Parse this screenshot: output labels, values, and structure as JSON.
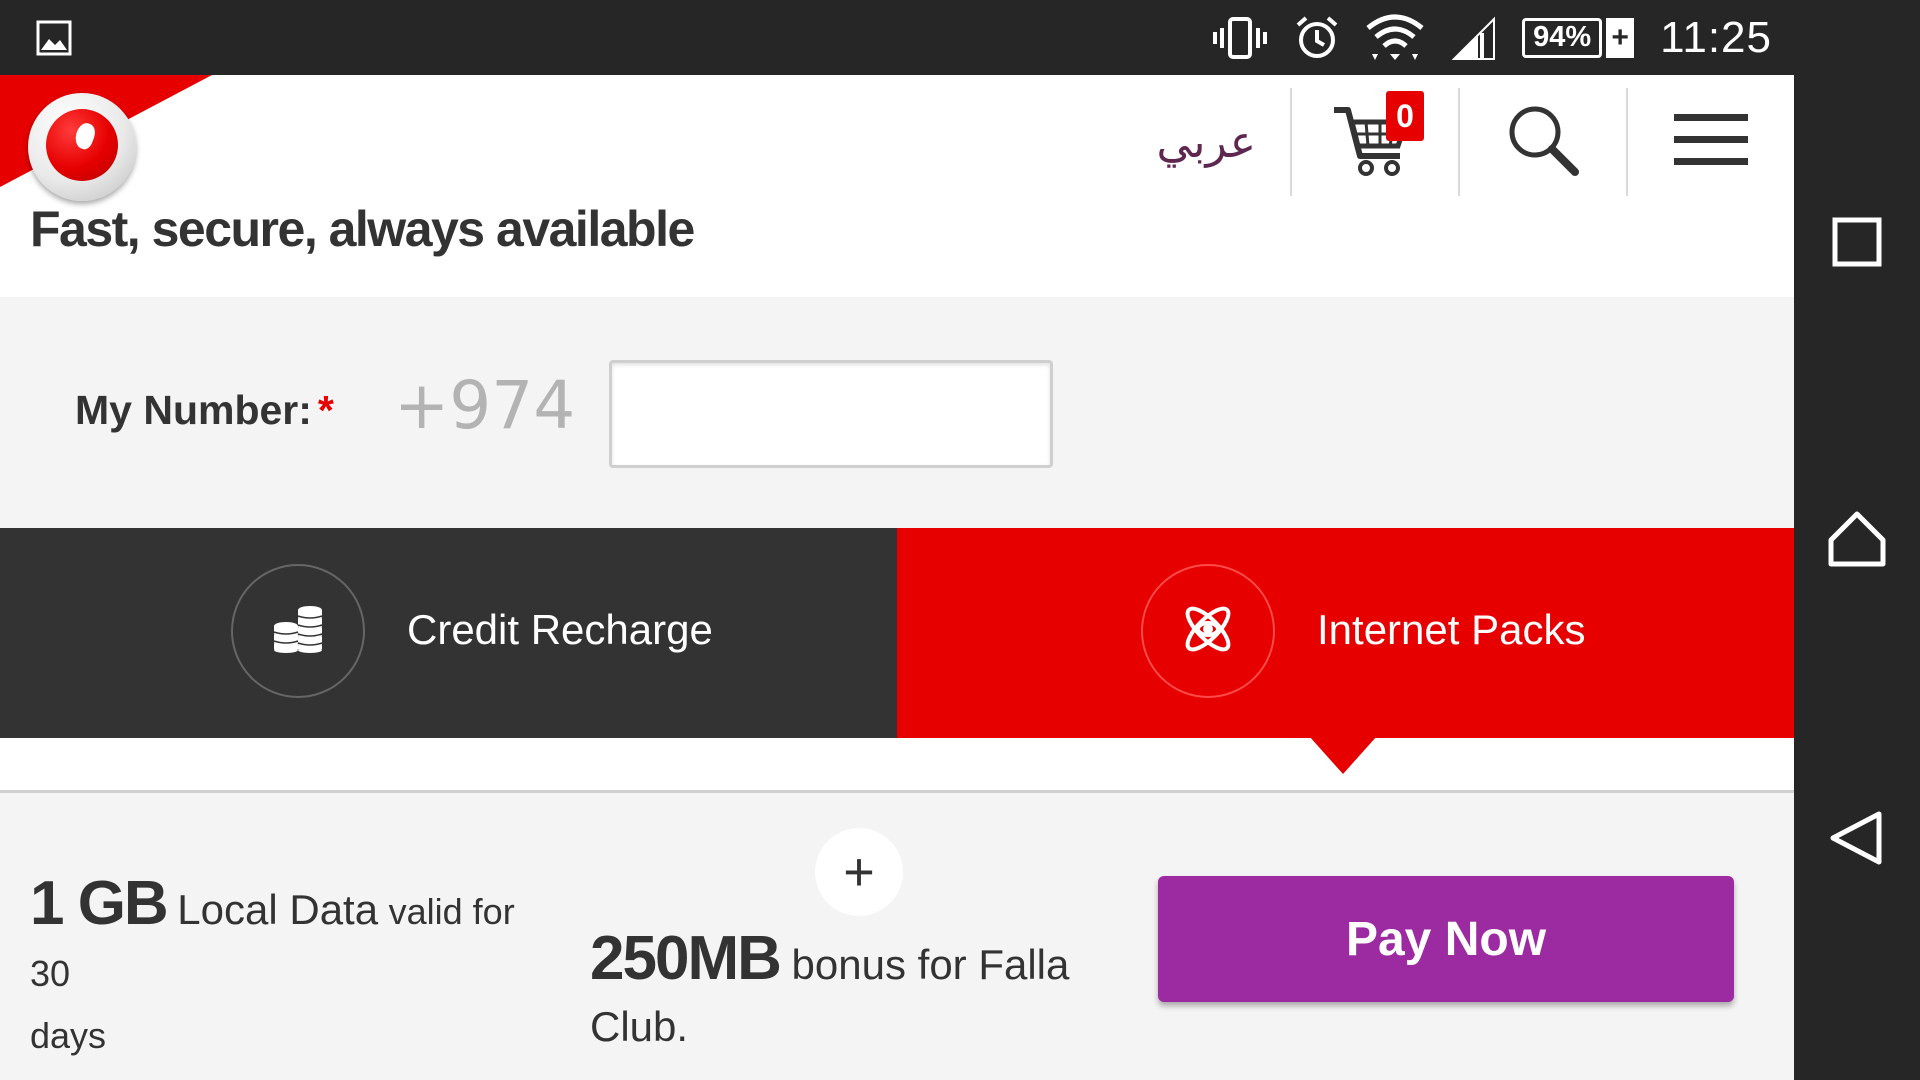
{
  "status_bar": {
    "battery": "94%",
    "battery_charging_symbol": "+",
    "time": "11:25",
    "icons": [
      "gallery-icon",
      "vibrate-icon",
      "alarm-icon",
      "wifi-icon",
      "cellular-signal-icon",
      "battery-icon"
    ]
  },
  "header": {
    "tagline": "Fast, secure, always available",
    "language_link": "عربي",
    "cart_count": "0"
  },
  "form": {
    "label": "My Number:",
    "required_mark": "*",
    "prefix": "+974",
    "input_value": ""
  },
  "tabs": [
    {
      "label": "Credit Recharge",
      "icon": "coins-icon",
      "active": false
    },
    {
      "label": "Internet Packs",
      "icon": "atom-icon",
      "active": true
    }
  ],
  "offer": {
    "amount": "1 GB",
    "amount_desc": "Local Data",
    "validity": "valid for 30",
    "validity_suffix": "days",
    "plus": "+",
    "bonus_amount": "250MB",
    "bonus_desc": "bonus for Falla",
    "bonus_suffix": "Club.",
    "pay_button": "Pay Now"
  },
  "colors": {
    "brand_red": "#e60000",
    "dark_tab": "#333333",
    "pay_button": "#9c2aa0",
    "arabic_link": "#5e2750"
  }
}
